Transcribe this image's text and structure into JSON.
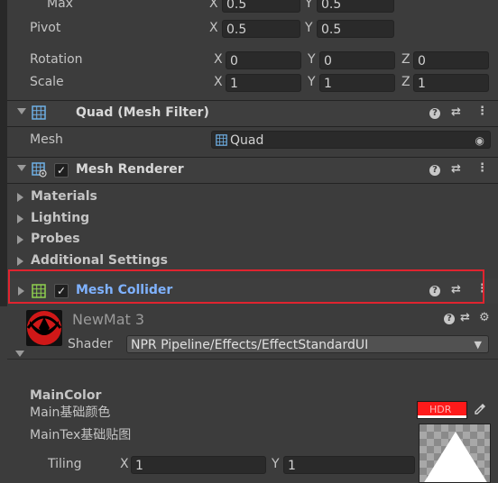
{
  "transform": {
    "max": {
      "label": "Max",
      "x": "0.5",
      "y": "0.5"
    },
    "pivot": {
      "label": "Pivot",
      "x": "0.5",
      "y": "0.5"
    },
    "rotation": {
      "label": "Rotation",
      "x": "0",
      "y": "0",
      "z": "0"
    },
    "scale": {
      "label": "Scale",
      "x": "1",
      "y": "1",
      "z": "1"
    },
    "axes": {
      "x": "X",
      "y": "Y",
      "z": "Z"
    }
  },
  "mesh_filter": {
    "title": "Quad (Mesh Filter)",
    "mesh_label": "Mesh",
    "mesh_value": "Quad"
  },
  "mesh_renderer": {
    "title": "Mesh Renderer",
    "enabled": true,
    "sections": [
      "Materials",
      "Lighting",
      "Probes",
      "Additional Settings"
    ]
  },
  "mesh_collider": {
    "title": "Mesh Collider",
    "enabled": true,
    "highlight_color": "#e0242f",
    "title_color": "#7fb2ff"
  },
  "material": {
    "name": "NewMat 3",
    "shader_label": "Shader",
    "shader_value": "NPR Pipeline/Effects/EffectStandardUI",
    "main_color_heading": "MainColor",
    "main_color_label": "Main基础颜色",
    "hdr_badge": "HDR",
    "main_color_value": "#ff1a1a",
    "main_tex_label": "MainTex基础贴图",
    "tiling_label": "Tiling",
    "tiling_x": "1",
    "tiling_y": "1"
  }
}
